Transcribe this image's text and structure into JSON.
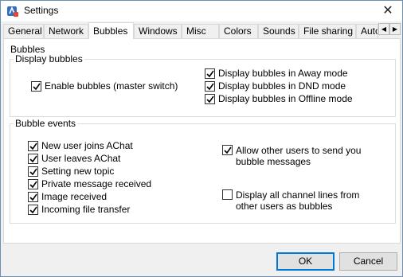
{
  "window": {
    "title": "Settings"
  },
  "tabs": [
    {
      "label": "General",
      "active": false
    },
    {
      "label": "Network",
      "active": false
    },
    {
      "label": "Bubbles",
      "active": true
    },
    {
      "label": "Windows",
      "active": false
    },
    {
      "label": "Misc",
      "active": false
    },
    {
      "label": "Colors",
      "active": false
    },
    {
      "label": "Sounds",
      "active": false
    },
    {
      "label": "File sharing",
      "active": false
    },
    {
      "label": "Auto",
      "active": false
    }
  ],
  "panel": {
    "heading": "Bubbles",
    "display_bubbles": {
      "title": "Display bubbles",
      "enable": {
        "label": "Enable bubbles (master switch)",
        "checked": true
      },
      "away": {
        "label": "Display bubbles in Away mode",
        "checked": true
      },
      "dnd": {
        "label": "Display bubbles in DND mode",
        "checked": true
      },
      "offline": {
        "label": "Display bubbles in Offline mode",
        "checked": true
      }
    },
    "bubble_events": {
      "title": "Bubble events",
      "joins": {
        "label": "New user joins AChat",
        "checked": true
      },
      "leaves": {
        "label": "User leaves AChat",
        "checked": true
      },
      "topic": {
        "label": "Setting new topic",
        "checked": true
      },
      "private": {
        "label": "Private message received",
        "checked": true
      },
      "image": {
        "label": "Image received",
        "checked": true
      },
      "file": {
        "label": "Incoming file transfer",
        "checked": true
      },
      "allow_others": {
        "label": "Allow other users to send you bubble messages",
        "checked": true
      },
      "all_lines": {
        "label": "Display all channel lines from other users as bubbles",
        "checked": false
      }
    }
  },
  "footer": {
    "ok_label": "OK",
    "cancel_label": "Cancel"
  }
}
